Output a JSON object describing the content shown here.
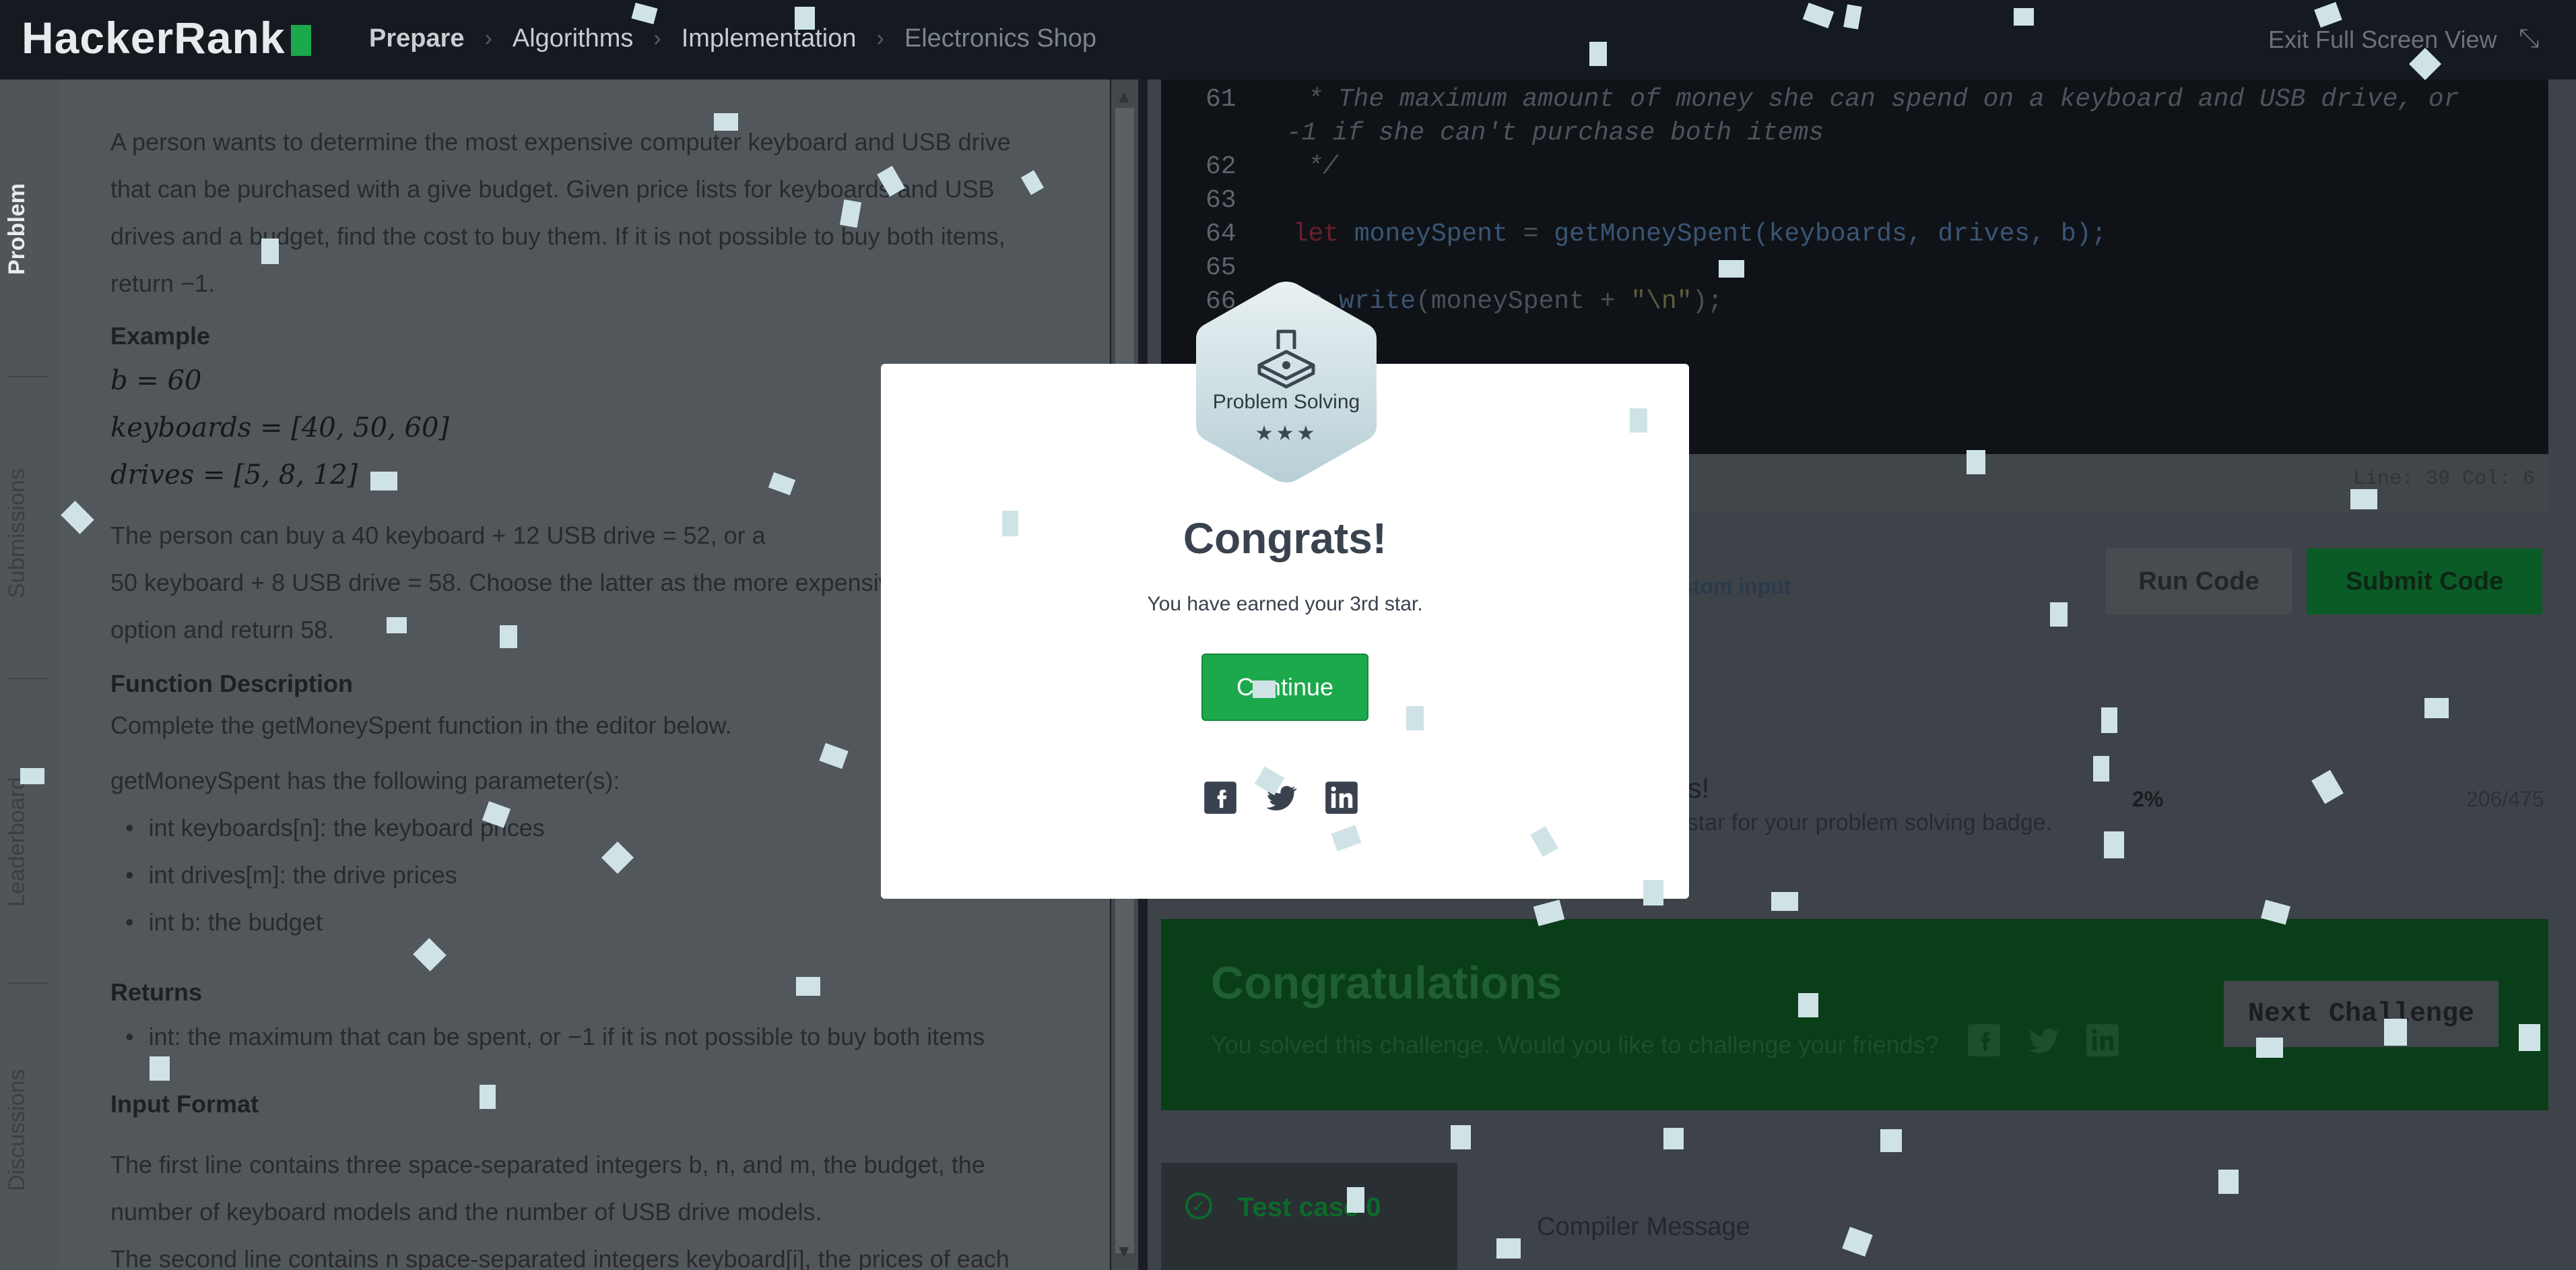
{
  "header": {
    "logo": "HackerRank",
    "breadcrumbs": [
      "Prepare",
      "Algorithms",
      "Implementation",
      "Electronics Shop"
    ],
    "exit_fullscreen": "Exit Full Screen View"
  },
  "sidebar": {
    "tabs": [
      "Problem",
      "Submissions",
      "Leaderboard",
      "Discussions"
    ]
  },
  "problem": {
    "intro_1": "A person wants to determine the most expensive computer keyboard and USB drive",
    "intro_2": "that can be purchased with a give budget. Given price lists for keyboards and USB",
    "intro_3": "drives and a budget, find the cost to buy them. If it is not possible to buy both items,",
    "intro_4": "return −1.",
    "example_heading": "Example",
    "ex_b": "b = 60",
    "ex_keyboards": "keyboards = [40, 50, 60]",
    "ex_drives": "drives = [5, 8, 12]",
    "expl_1": "The person can buy a 40 keyboard + 12 USB drive = 52, or a",
    "expl_2": "50 keyboard + 8 USB drive = 58. Choose the latter as the more expensive",
    "expl_3": "option and return 58.",
    "fd_heading": "Function Description",
    "fd_1": "Complete the getMoneySpent function in the editor below.",
    "fd_2": "getMoneySpent has the following parameter(s):",
    "params": [
      "int keyboards[n]: the keyboard prices",
      "int drives[m]: the drive prices",
      "int b: the budget"
    ],
    "returns_heading": "Returns",
    "returns": [
      "int: the maximum that can be spent, or −1 if it is not possible to buy both items"
    ],
    "input_heading": "Input Format",
    "input_1": "The first line contains three space-separated integers b, n, and m, the budget, the",
    "input_2": "number of keyboard models and the number of USB drive models.",
    "input_3": "The second line contains n space-separated integers keyboard[i], the prices of each"
  },
  "editor": {
    "lines": [
      {
        "n": "61",
        "text": "  * The maximum amount of money she can spend on a keyboard and USB drive, or"
      },
      {
        "n": "",
        "text": "-1 if she can't purchase both items"
      },
      {
        "n": "62",
        "text": "  */"
      },
      {
        "n": "63",
        "text": ""
      },
      {
        "n": "64",
        "text": ""
      },
      {
        "n": "65",
        "text": ""
      },
      {
        "n": "66",
        "text": ""
      }
    ],
    "line64": {
      "kw": "let",
      "var": " moneySpent",
      "eq": " = ",
      "fn": "getMoneySpent",
      "args": "(keyboards, drives, b);"
    },
    "line66": {
      "obj": "ws",
      "dot": ".",
      "fn": "write",
      "args": "(moneySpent + ",
      "str": "\"\\n\"",
      "end": ");"
    },
    "cursor_status": "Line: 39 Col: 6"
  },
  "actions": {
    "custom_input": "stom input",
    "run_code": "Run Code",
    "submit_code": "Submit Code"
  },
  "progress": {
    "label": "ts!",
    "description": "4th star for your problem solving badge.",
    "percent": "2%",
    "count": "206/475"
  },
  "congrats_bar": {
    "title": "Congratulations",
    "subtitle": "You solved this challenge. Would you like to challenge your friends?",
    "next": "Next Challenge"
  },
  "tests": {
    "case": "Test case 0",
    "compiler": "Compiler Message"
  },
  "modal": {
    "badge_title": "Problem Solving",
    "badge_stars": "★★★",
    "title": "Congrats!",
    "text": "You have earned your 3rd star.",
    "continue": "Continue"
  },
  "colors": {
    "brand_green": "#1ba94c",
    "modal_bg": "#ffffff",
    "overlay": "#50555a"
  }
}
